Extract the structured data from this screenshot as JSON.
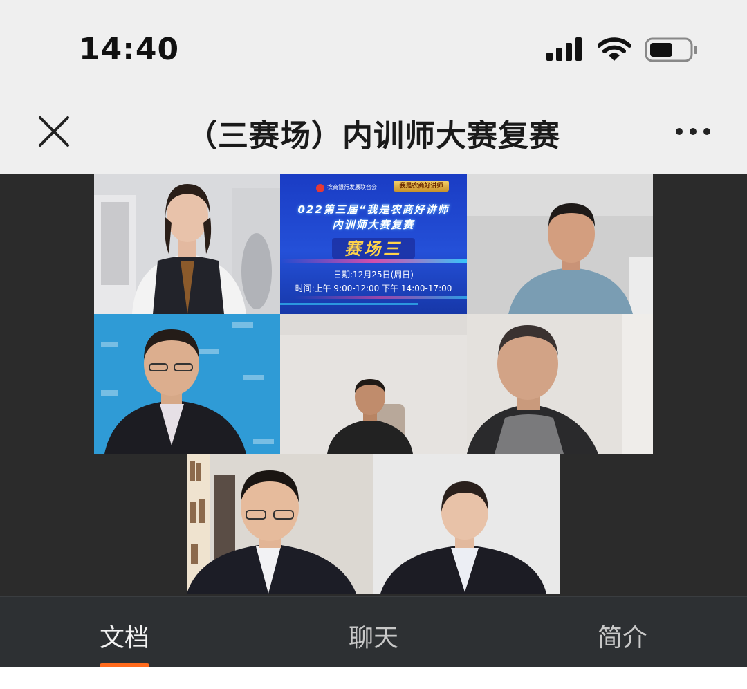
{
  "status_bar": {
    "time": "14:40",
    "signal_icon": "cellular-signal-icon",
    "wifi_icon": "wifi-icon",
    "battery_icon": "battery-icon"
  },
  "title_bar": {
    "title": "（三赛场）内训师大赛复赛",
    "close_icon": "close-icon",
    "more_icon": "more-dots-icon"
  },
  "video_grid": {
    "banner": {
      "org": "农商银行发展联合会",
      "badge": "我是农商好讲师",
      "title_line1": "022第三届“我是农商好讲师",
      "title_line2": "内训师大赛复赛",
      "field": "赛场三",
      "date": "日期:12月25日(周日)",
      "time": "时间:上午 9:00-12:00 下午 14:00-17:00"
    }
  },
  "tabs": [
    {
      "label": "文档",
      "active": true
    },
    {
      "label": "聊天",
      "active": false
    },
    {
      "label": "简介",
      "active": false
    }
  ],
  "colors": {
    "accent": "#ff6a1c",
    "tab_bar_bg": "#2d3033",
    "video_bg": "#2b2b2b",
    "banner_blue": "#1d3fb8"
  }
}
